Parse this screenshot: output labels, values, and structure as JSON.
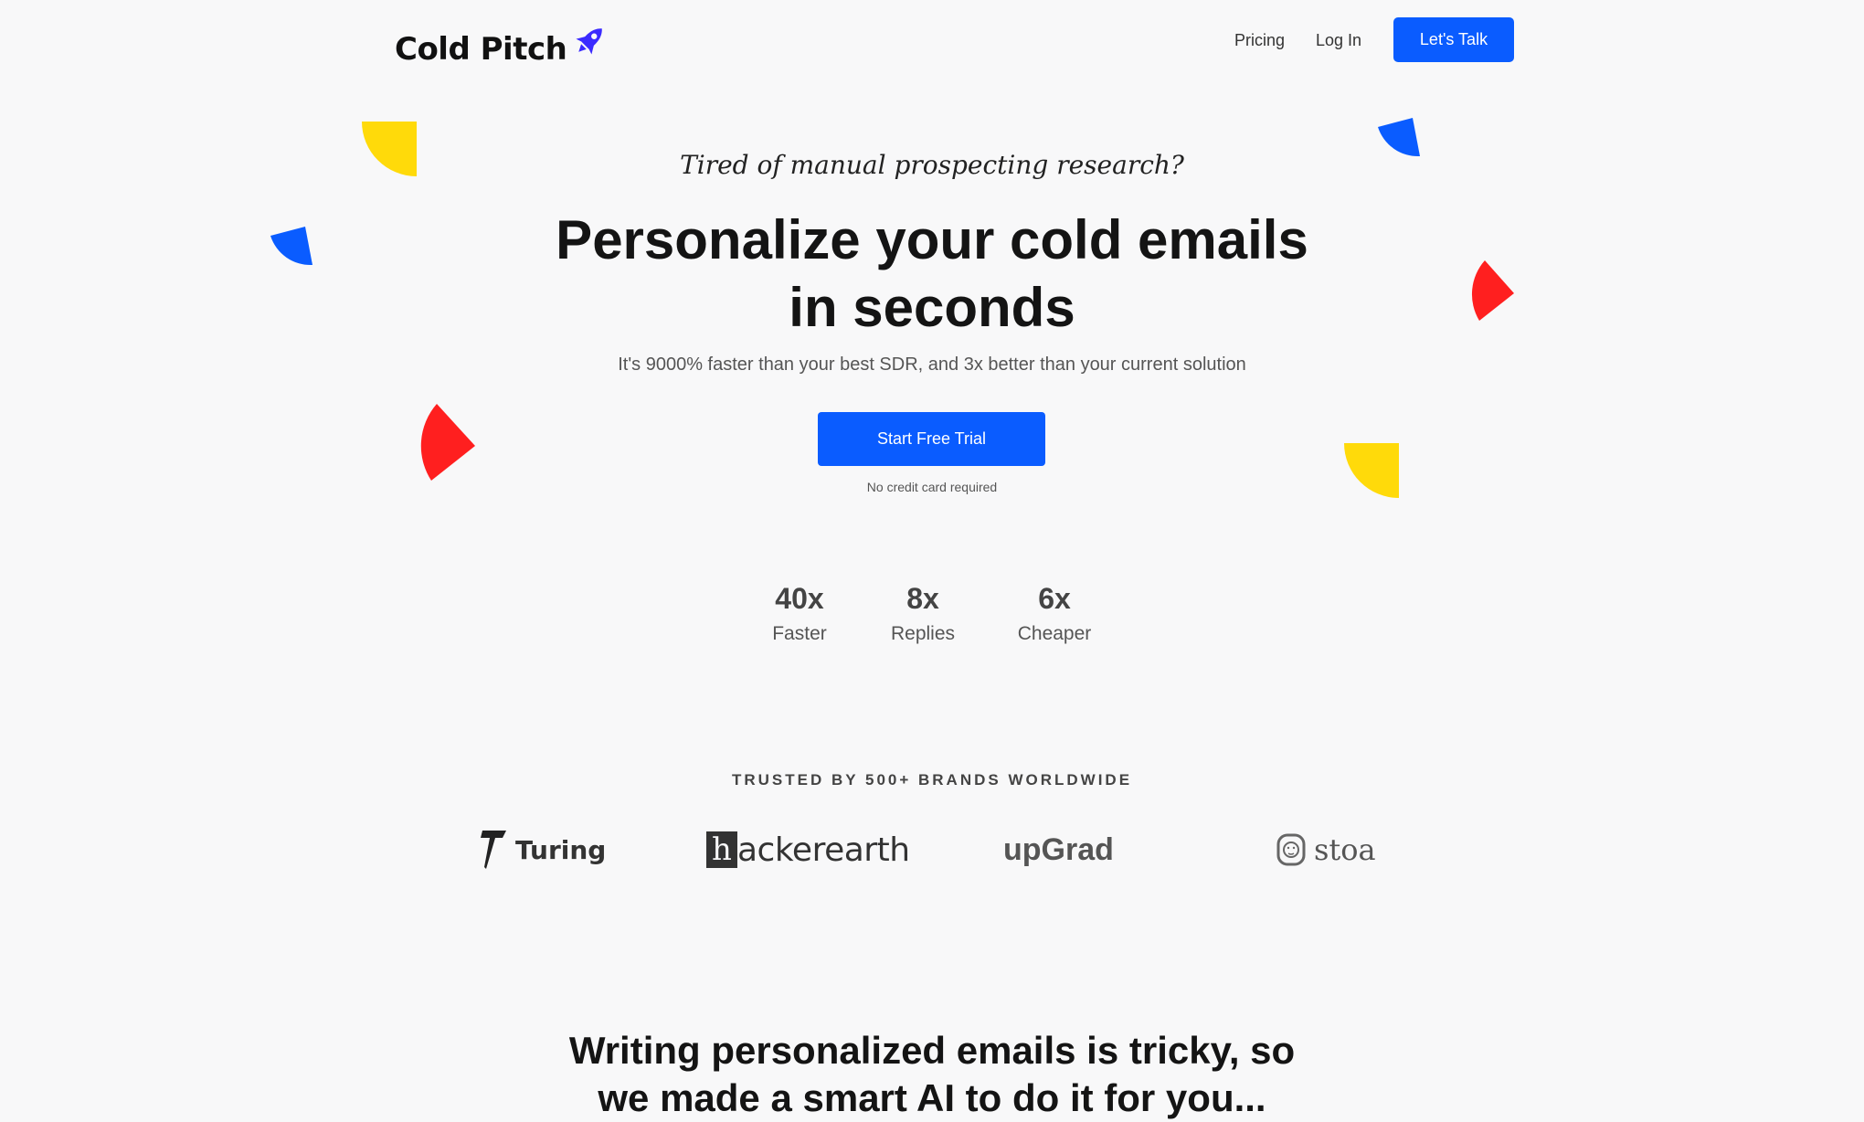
{
  "header": {
    "brand": "Cold Pitch",
    "brand_icon": "rocket-icon",
    "nav": [
      {
        "label": "Pricing"
      },
      {
        "label": "Log In"
      }
    ],
    "cta_label": "Let's Talk"
  },
  "hero": {
    "tagline": "Tired of manual prospecting research?",
    "headline_line1": "Personalize your cold emails",
    "headline_line2": "in seconds",
    "subheadline": "It's 9000% faster than your best SDR, and 3x better than your current solution",
    "cta_label": "Start Free Trial",
    "cta_note": "No credit card required"
  },
  "stats": [
    {
      "value": "40x",
      "label": "Faster"
    },
    {
      "value": "8x",
      "label": "Replies"
    },
    {
      "value": "6x",
      "label": "Cheaper"
    }
  ],
  "trusted": {
    "heading": "TRUSTED BY 500+ BRANDS WORLDWIDE",
    "brands": [
      {
        "name": "Turing",
        "icon": "turing-logo-icon"
      },
      {
        "name": "ackerearth",
        "prefix": "h",
        "icon": "hackerearth-logo-icon"
      },
      {
        "name": "upGrad"
      },
      {
        "name": "stoa",
        "icon": "lion-logo-icon"
      }
    ]
  },
  "section2": {
    "heading_line1": "Writing personalized emails is tricky, so",
    "heading_line2": "we made a smart AI to do it for you..."
  },
  "colors": {
    "background": "#f8f8f9",
    "accent_blue": "#0a5cff",
    "brand_purple": "#3b2bff",
    "decor_yellow": "#ffda0a",
    "decor_red": "#ff1f1f",
    "decor_blue": "#0a5cff"
  }
}
